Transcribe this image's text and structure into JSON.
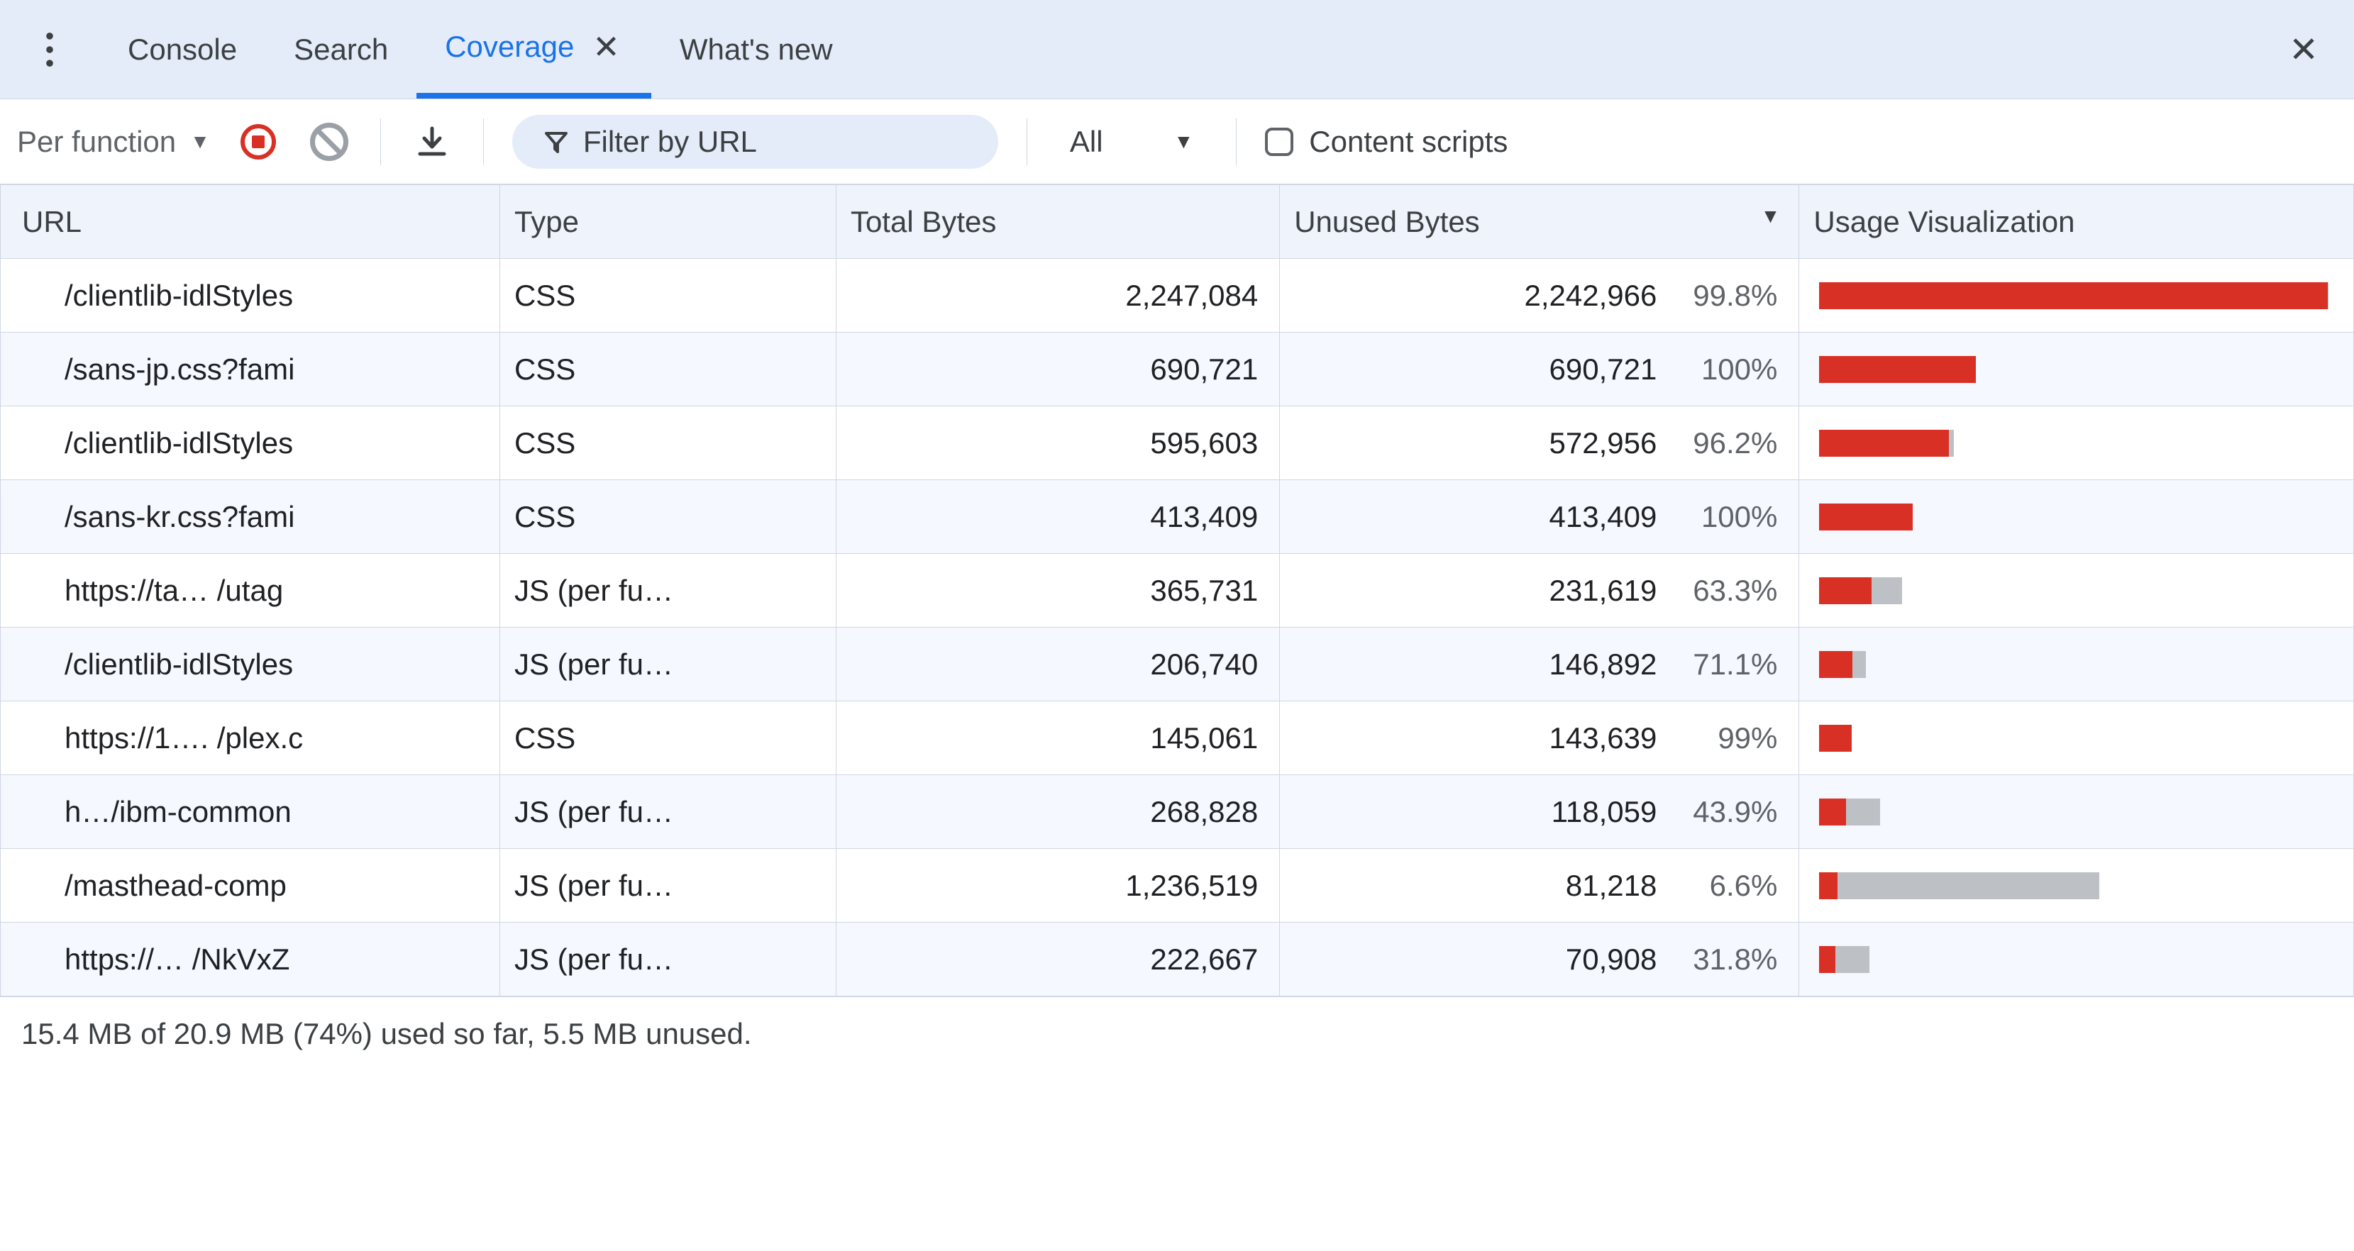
{
  "tabs": {
    "items": [
      {
        "label": "Console",
        "active": false,
        "closable": false
      },
      {
        "label": "Search",
        "active": false,
        "closable": false
      },
      {
        "label": "Coverage",
        "active": true,
        "closable": true
      },
      {
        "label": "What's new",
        "active": false,
        "closable": false
      }
    ]
  },
  "toolbar": {
    "granularity": "Per function",
    "filter_placeholder": "Filter by URL",
    "type_filter": "All",
    "content_scripts_label": "Content scripts"
  },
  "columns": {
    "url": "URL",
    "type": "Type",
    "total": "Total Bytes",
    "unused": "Unused Bytes",
    "viz": "Usage Visualization"
  },
  "footer": "15.4 MB of 20.9 MB (74%) used so far, 5.5 MB unused.",
  "viz_max_bytes": 2247084,
  "rows": [
    {
      "url": "/clientlib-idlStyles",
      "type": "CSS",
      "total": "2,247,084",
      "unused": "2,242,966",
      "pct": "99.8%",
      "total_n": 2247084,
      "unused_n": 2242966
    },
    {
      "url": "/sans-jp.css?fami",
      "type": "CSS",
      "total": "690,721",
      "unused": "690,721",
      "pct": "100%",
      "total_n": 690721,
      "unused_n": 690721
    },
    {
      "url": "/clientlib-idlStyles",
      "type": "CSS",
      "total": "595,603",
      "unused": "572,956",
      "pct": "96.2%",
      "total_n": 595603,
      "unused_n": 572956
    },
    {
      "url": "/sans-kr.css?fami",
      "type": "CSS",
      "total": "413,409",
      "unused": "413,409",
      "pct": "100%",
      "total_n": 413409,
      "unused_n": 413409
    },
    {
      "url": "https://ta…  /utag",
      "type": "JS (per fu…",
      "total": "365,731",
      "unused": "231,619",
      "pct": "63.3%",
      "total_n": 365731,
      "unused_n": 231619
    },
    {
      "url": "/clientlib-idlStyles",
      "type": "JS (per fu…",
      "total": "206,740",
      "unused": "146,892",
      "pct": "71.1%",
      "total_n": 206740,
      "unused_n": 146892
    },
    {
      "url": "https://1…. /plex.c",
      "type": "CSS",
      "total": "145,061",
      "unused": "143,639",
      "pct": "99%",
      "total_n": 145061,
      "unused_n": 143639
    },
    {
      "url": "h…/ibm-common",
      "type": "JS (per fu…",
      "total": "268,828",
      "unused": "118,059",
      "pct": "43.9%",
      "total_n": 268828,
      "unused_n": 118059
    },
    {
      "url": "/masthead-comp",
      "type": "JS (per fu…",
      "total": "1,236,519",
      "unused": "81,218",
      "pct": "6.6%",
      "total_n": 1236519,
      "unused_n": 81218
    },
    {
      "url": "https://…  /NkVxZ",
      "type": "JS (per fu…",
      "total": "222,667",
      "unused": "70,908",
      "pct": "31.8%",
      "total_n": 222667,
      "unused_n": 70908
    }
  ]
}
